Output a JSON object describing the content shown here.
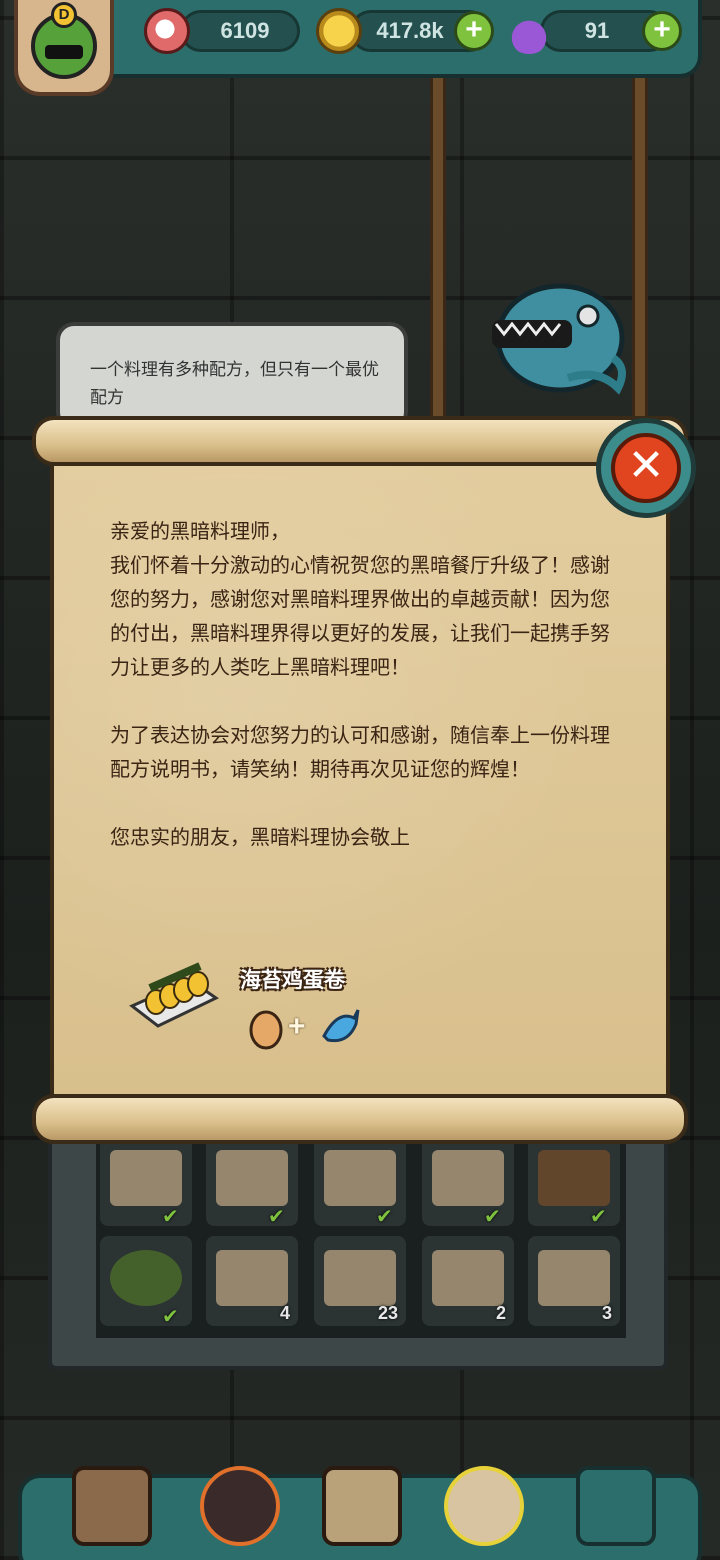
{
  "header": {
    "rank_letter": "D",
    "eyeballs": "6109",
    "coins": "417.8k",
    "potions": "91"
  },
  "speech_bubble": {
    "text": "一个料理有多种配方，但只有一个最优配方"
  },
  "letter": {
    "greeting": "亲爱的黑暗料理师，",
    "paragraph1": "我们怀着十分激动的心情祝贺您的黑暗餐厅升级了！感谢您的努力，感谢您对黑暗料理界做出的卓越贡献！因为您的付出，黑暗料理界得以更好的发展，让我们一起携手努力让更多的人类吃上黑暗料理吧！",
    "paragraph2": "为了表达协会对您努力的认可和感谢，随信奉上一份料理配方说明书，请笑纳！期待再次见证您的辉煌！",
    "signature": "您忠实的朋友，黑暗料理协会敬上"
  },
  "recipe": {
    "name": "海苔鸡蛋卷",
    "ingredients": [
      "egg-icon",
      "fish-icon"
    ],
    "plus": "+"
  },
  "grid": {
    "row1": [
      {
        "icon": "recipe-scroll-icon",
        "done": true
      },
      {
        "icon": "recipe-scroll-icon",
        "done": true
      },
      {
        "icon": "recipe-scroll-icon",
        "done": true
      },
      {
        "icon": "recipe-scroll-icon",
        "done": true
      },
      {
        "icon": "recipe-map-icon",
        "done": true
      }
    ],
    "row2": [
      {
        "icon": "tentacle-plant-icon",
        "done": true,
        "count": ""
      },
      {
        "icon": "ufo-ticket-icon",
        "count": "4"
      },
      {
        "icon": "vehicle-ticket-icon",
        "count": "23"
      },
      {
        "icon": "helicopter-ticket-icon",
        "count": "2"
      },
      {
        "icon": "tank-ticket-icon",
        "count": "3"
      }
    ],
    "check": "✔"
  },
  "close_glyph": "✕"
}
